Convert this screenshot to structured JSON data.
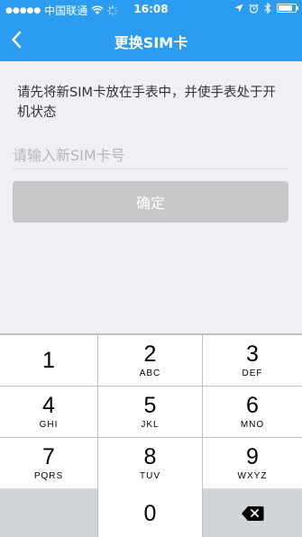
{
  "status_bar": {
    "carrier": "中国联通",
    "time": "16:08",
    "battery_level": 0.85,
    "icons": [
      "signal-dots-icon",
      "wifi-icon",
      "loading-icon",
      "location-arrow-icon",
      "alarm-icon",
      "bluetooth-icon",
      "battery-icon"
    ]
  },
  "navbar": {
    "title": "更换SIM卡",
    "back_icon": "chevron-left-icon"
  },
  "main": {
    "instruction": "请先将新SIM卡放在手表中，并使手表处于开机状态",
    "sim_input": {
      "value": "",
      "placeholder": "请输入新SIM卡号"
    },
    "confirm_label": "确定"
  },
  "keypad": {
    "keys": [
      {
        "num": "1",
        "letters": ""
      },
      {
        "num": "2",
        "letters": "ABC"
      },
      {
        "num": "3",
        "letters": "DEF"
      },
      {
        "num": "4",
        "letters": "GHI"
      },
      {
        "num": "5",
        "letters": "JKL"
      },
      {
        "num": "6",
        "letters": "MNO"
      },
      {
        "num": "7",
        "letters": "PQRS"
      },
      {
        "num": "8",
        "letters": "TUV"
      },
      {
        "num": "9",
        "letters": "WXYZ"
      },
      {
        "num": "0",
        "letters": ""
      }
    ],
    "delete_icon": "backspace-icon"
  },
  "colors": {
    "accent": "#2b9cf0",
    "page_background": "#efeff4",
    "button_disabled": "#c8c8ca",
    "keypad_background": "#bcbfc6"
  }
}
